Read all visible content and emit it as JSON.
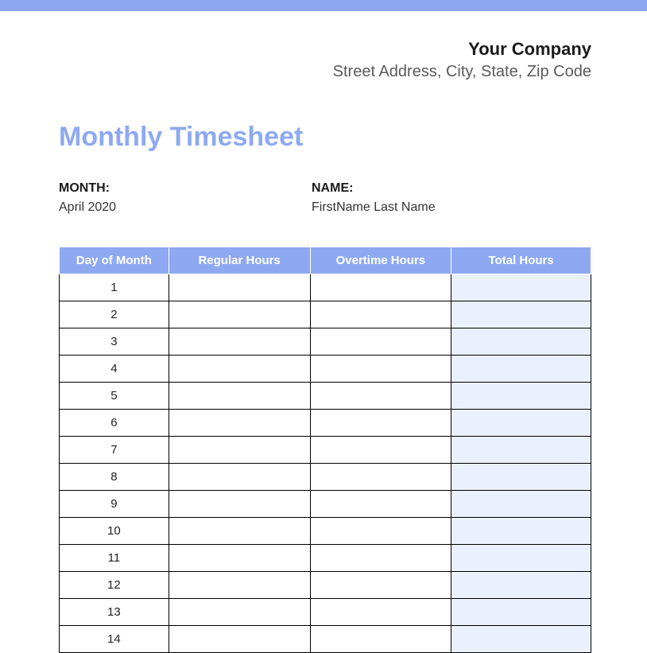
{
  "header": {
    "company_name": "Your Company",
    "company_address": "Street Address, City, State, Zip Code"
  },
  "title": "Monthly Timesheet",
  "meta": {
    "month_label": "MONTH:",
    "month_value": "April 2020",
    "name_label": "NAME:",
    "name_value": "FirstName Last Name"
  },
  "table": {
    "headers": {
      "day": "Day of Month",
      "regular": "Regular Hours",
      "overtime": "Overtime Hours",
      "total": "Total Hours"
    },
    "rows": [
      {
        "day": "1",
        "regular": "",
        "overtime": "",
        "total": ""
      },
      {
        "day": "2",
        "regular": "",
        "overtime": "",
        "total": ""
      },
      {
        "day": "3",
        "regular": "",
        "overtime": "",
        "total": ""
      },
      {
        "day": "4",
        "regular": "",
        "overtime": "",
        "total": ""
      },
      {
        "day": "5",
        "regular": "",
        "overtime": "",
        "total": ""
      },
      {
        "day": "6",
        "regular": "",
        "overtime": "",
        "total": ""
      },
      {
        "day": "7",
        "regular": "",
        "overtime": "",
        "total": ""
      },
      {
        "day": "8",
        "regular": "",
        "overtime": "",
        "total": ""
      },
      {
        "day": "9",
        "regular": "",
        "overtime": "",
        "total": ""
      },
      {
        "day": "10",
        "regular": "",
        "overtime": "",
        "total": ""
      },
      {
        "day": "11",
        "regular": "",
        "overtime": "",
        "total": ""
      },
      {
        "day": "12",
        "regular": "",
        "overtime": "",
        "total": ""
      },
      {
        "day": "13",
        "regular": "",
        "overtime": "",
        "total": ""
      },
      {
        "day": "14",
        "regular": "",
        "overtime": "",
        "total": ""
      }
    ]
  }
}
